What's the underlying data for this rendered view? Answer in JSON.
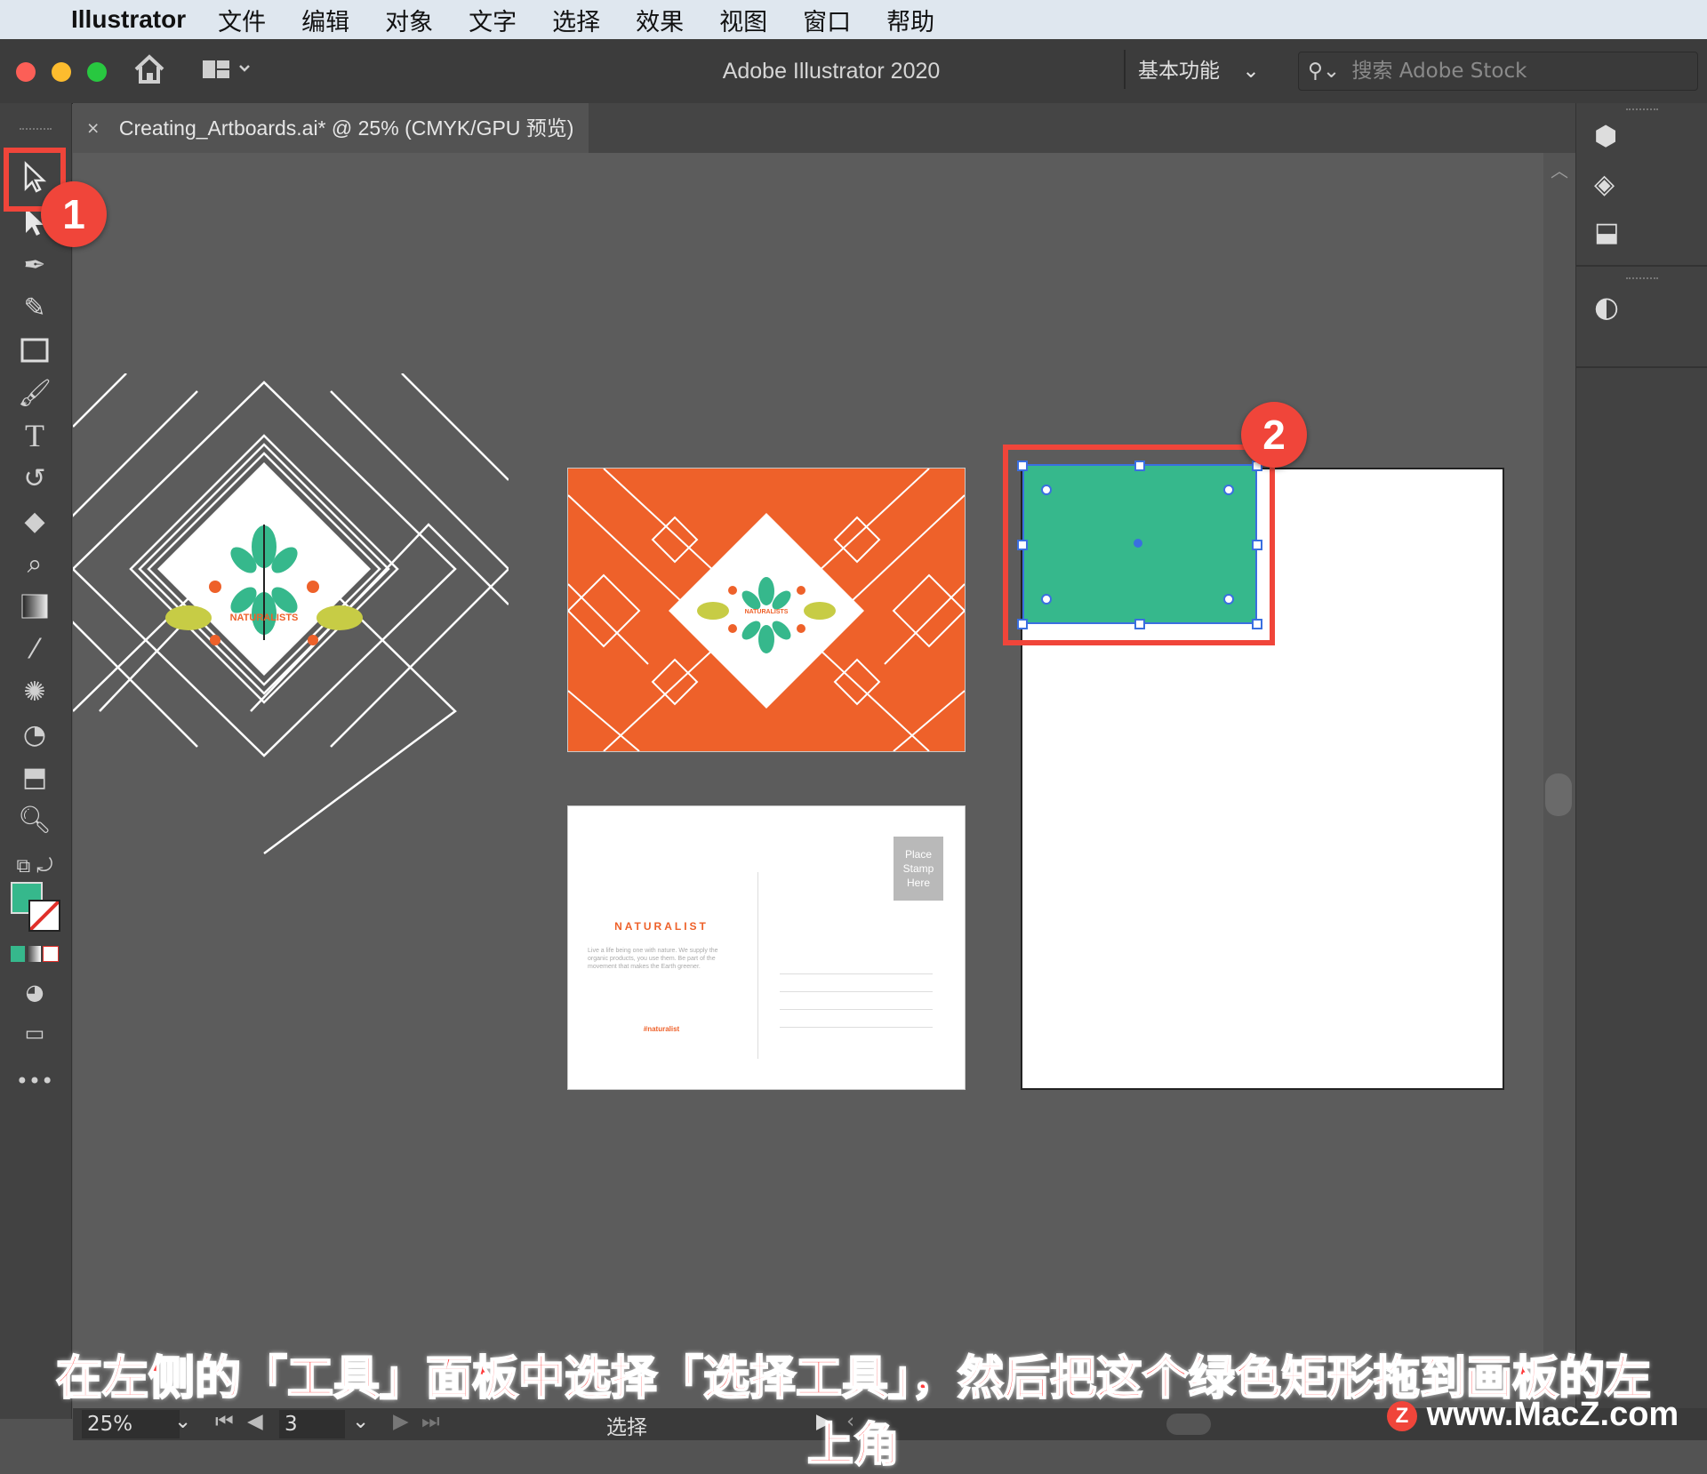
{
  "menubar": {
    "app_name": "Illustrator",
    "items": [
      "文件",
      "编辑",
      "对象",
      "文字",
      "选择",
      "效果",
      "视图",
      "窗口",
      "帮助"
    ]
  },
  "window": {
    "title": "Adobe Illustrator 2020",
    "workspace": "基本功能",
    "search_placeholder": "搜索 Adobe Stock"
  },
  "document_tab": {
    "label": "Creating_Artboards.ai* @ 25% (CMYK/GPU 预览)"
  },
  "artwork": {
    "logo_text": "NATURALISTS",
    "postcard_heading": "NATURALIST",
    "postcard_body": "Live a life being one with nature. We supply the organic products, you use them. Be part of the movement that makes the Earth greener.",
    "postcard_hashtag": "#naturalist",
    "stamp_text": "Place Stamp Here"
  },
  "status": {
    "zoom": "25%",
    "artboard_number": "3",
    "tool_name": "选择"
  },
  "annotations": {
    "badge1": "1",
    "badge2": "2",
    "caption": "在左侧的「工具」面板中选择「选择工具」，然后把这个绿色矩形拖到画板的左上角",
    "watermark": "www.MacZ.com"
  },
  "colors": {
    "green_fill": "#36b88c",
    "orange": "#ee612a",
    "annotation_red": "#f0453a"
  },
  "icons": [
    "apple-icon",
    "home-icon",
    "layout-icon",
    "search-icon",
    "selection-tool-icon",
    "direct-selection-icon",
    "pen-tool-icon",
    "curvature-tool-icon",
    "rectangle-tool-icon",
    "paintbrush-icon",
    "type-tool-icon",
    "rotate-tool-icon",
    "eraser-icon",
    "width-tool-icon",
    "gradient-icon",
    "eyedropper-icon",
    "puppet-warp-icon",
    "shape-builder-icon",
    "artboard-tool-icon",
    "zoom-tool-icon",
    "libraries-icon",
    "layers-icon",
    "artboards-panel-icon",
    "color-guide-icon"
  ]
}
